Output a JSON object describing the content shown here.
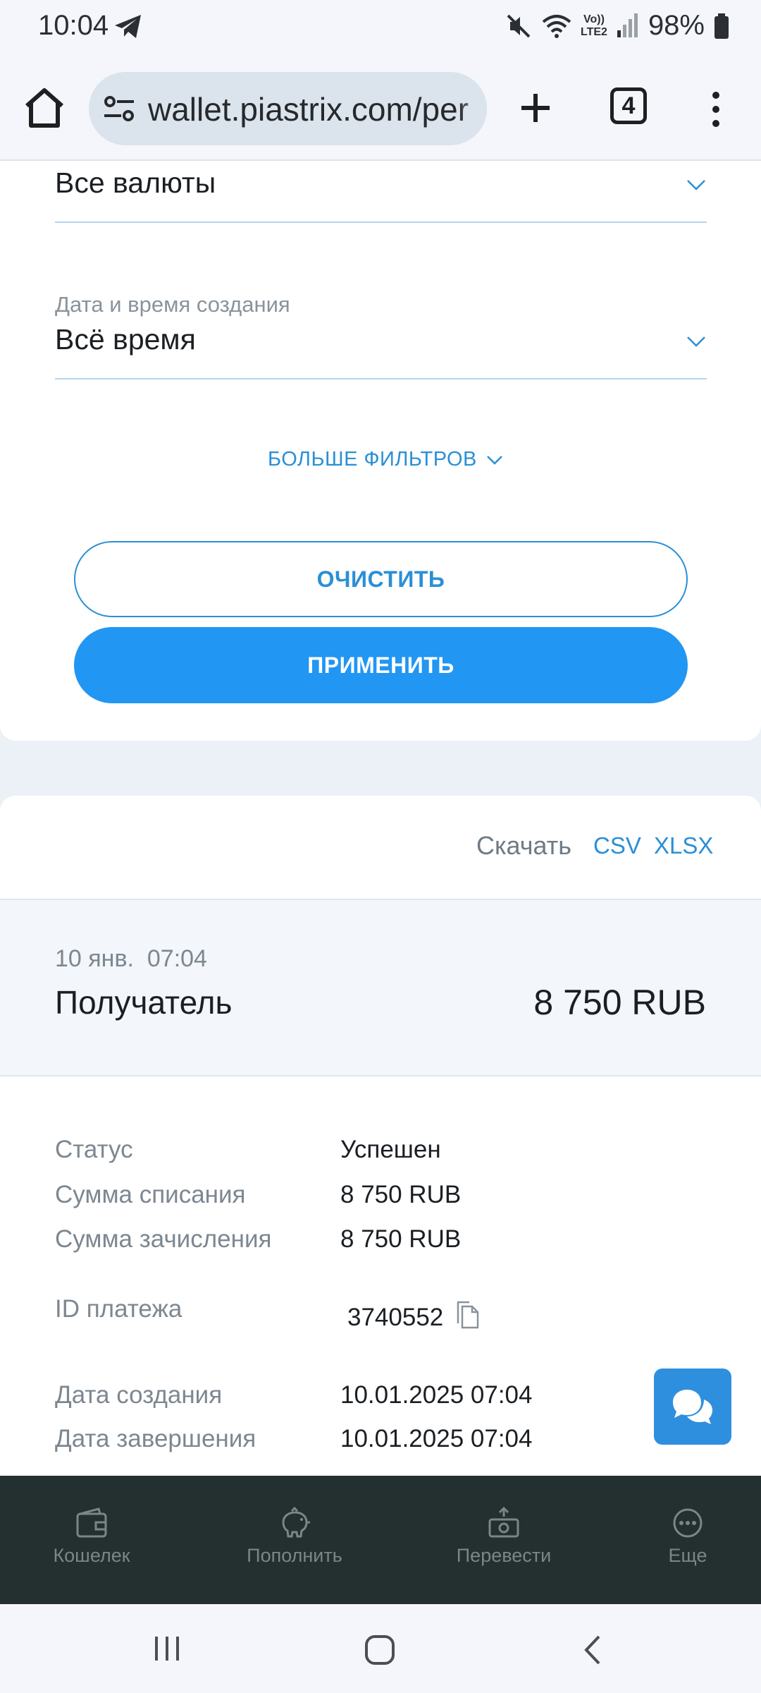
{
  "status_bar": {
    "time": "10:04",
    "network_label_top": "Vo))",
    "network_label_bottom": "LTE2",
    "battery": "98%"
  },
  "browser": {
    "url": "wallet.piastrix.com/per",
    "tab_count": "4"
  },
  "filters": {
    "currency": {
      "value": "Все валюты"
    },
    "created_at": {
      "label": "Дата и время создания",
      "value": "Всё время"
    },
    "more_filters": "БОЛЬШЕ ФИЛЬТРОВ",
    "clear_button": "ОЧИСТИТЬ",
    "apply_button": "ПРИМЕНИТЬ"
  },
  "download": {
    "label": "Скачать",
    "csv": "CSV",
    "xlsx": "XLSX"
  },
  "transaction": {
    "date": "10 янв.",
    "time": "07:04",
    "party": "Получатель",
    "amount": "8 750 RUB",
    "details": [
      {
        "label": "Статус",
        "value": "Успешен"
      },
      {
        "label": "Сумма списания",
        "value": "8 750 RUB"
      },
      {
        "label": "Сумма зачисления",
        "value": "8 750 RUB"
      },
      {
        "label": "ID платежа",
        "value": "3740552"
      },
      {
        "label": "Дата создания",
        "value": "10.01.2025 07:04"
      },
      {
        "label": "Дата завершения",
        "value": "10.01.2025 07:04"
      }
    ]
  },
  "bottom_nav": [
    {
      "label": "Кошелек",
      "icon": "wallet-icon"
    },
    {
      "label": "Пополнить",
      "icon": "piggy-bank-icon"
    },
    {
      "label": "Перевести",
      "icon": "money-transfer-icon"
    },
    {
      "label": "Еще",
      "icon": "more-icon"
    }
  ],
  "colors": {
    "accent": "#2196f3",
    "link": "#2a8fd6",
    "nav_background": "#23302f",
    "nav_text": "#7b8686"
  }
}
